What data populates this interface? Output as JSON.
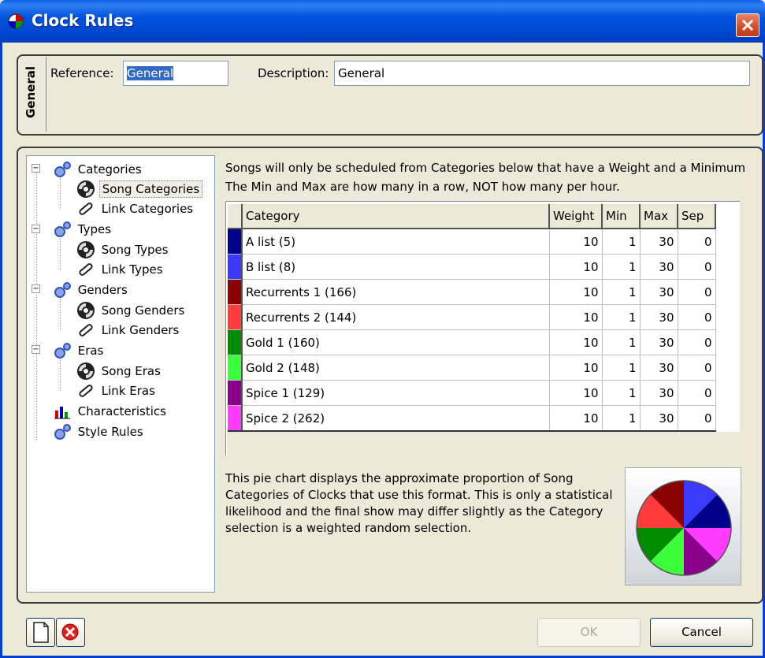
{
  "window": {
    "title": "Clock Rules"
  },
  "general": {
    "tab_label": "General",
    "reference_label": "Reference:",
    "reference_value": "General",
    "description_label": "Description:",
    "description_value": "General"
  },
  "tree": {
    "items": [
      {
        "label": "Categories",
        "icon": "gears-icon"
      },
      {
        "label": "Song Categories",
        "icon": "disc-icon",
        "selected": true
      },
      {
        "label": "Link Categories",
        "icon": "link-icon"
      },
      {
        "label": "Types",
        "icon": "gears-icon"
      },
      {
        "label": "Song Types",
        "icon": "disc-icon"
      },
      {
        "label": "Link Types",
        "icon": "link-icon"
      },
      {
        "label": "Genders",
        "icon": "gears-icon"
      },
      {
        "label": "Song Genders",
        "icon": "disc-icon"
      },
      {
        "label": "Link Genders",
        "icon": "link-icon"
      },
      {
        "label": "Eras",
        "icon": "gears-icon"
      },
      {
        "label": "Song Eras",
        "icon": "disc-icon"
      },
      {
        "label": "Link Eras",
        "icon": "link-icon"
      },
      {
        "label": "Characteristics",
        "icon": "bar-chart-icon"
      },
      {
        "label": "Style Rules",
        "icon": "gears-icon"
      }
    ]
  },
  "info": {
    "line1": "Songs will only be scheduled from Categories below that have a Weight and a Minimum",
    "line2": "The Min and Max are how many in a row, NOT how many per hour."
  },
  "grid": {
    "columns": [
      "Category",
      "Weight",
      "Min",
      "Max",
      "Sep"
    ],
    "rows": [
      {
        "color": "#00008b",
        "name": "A list   (5)",
        "weight": "10",
        "min": "1",
        "max": "30",
        "sep": "0"
      },
      {
        "color": "#3a3aff",
        "name": "B list   (8)",
        "weight": "10",
        "min": "1",
        "max": "30",
        "sep": "0"
      },
      {
        "color": "#8b0000",
        "name": "Recurrents 1  (166)",
        "weight": "10",
        "min": "1",
        "max": "30",
        "sep": "0"
      },
      {
        "color": "#ff3c3c",
        "name": "Recurrents 2  (144)",
        "weight": "10",
        "min": "1",
        "max": "30",
        "sep": "0"
      },
      {
        "color": "#008b00",
        "name": "Gold 1  (160)",
        "weight": "10",
        "min": "1",
        "max": "30",
        "sep": "0"
      },
      {
        "color": "#3cff3c",
        "name": "Gold 2  (148)",
        "weight": "10",
        "min": "1",
        "max": "30",
        "sep": "0"
      },
      {
        "color": "#8b008b",
        "name": "Spice 1    (129)",
        "weight": "10",
        "min": "1",
        "max": "30",
        "sep": "0"
      },
      {
        "color": "#ff3cff",
        "name": "Spice 2    (262)",
        "weight": "10",
        "min": "1",
        "max": "30",
        "sep": "0"
      }
    ]
  },
  "pie": {
    "line1": "This pie chart displays the approximate proportion of Song",
    "line2": "Categories of Clocks that use this format. This is only a statistical",
    "line3": "likelihood and the final show may differ slightly as the Category",
    "line4": "selection is a weighted random selection.",
    "slices": [
      {
        "color": "#3a3aff",
        "value": 10
      },
      {
        "color": "#00008b",
        "value": 10
      },
      {
        "color": "#ff3cff",
        "value": 10
      },
      {
        "color": "#8b008b",
        "value": 10
      },
      {
        "color": "#3cff3c",
        "value": 10
      },
      {
        "color": "#008b00",
        "value": 10
      },
      {
        "color": "#ff3c3c",
        "value": 10
      },
      {
        "color": "#8b0000",
        "value": 10
      }
    ]
  },
  "buttons": {
    "ok": "OK",
    "cancel": "Cancel"
  }
}
